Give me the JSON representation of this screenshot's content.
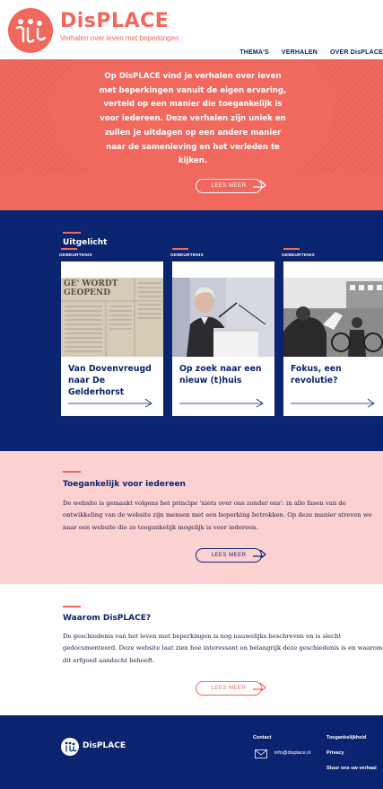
{
  "header": {
    "brand": "DisPLACE",
    "tagline": "Verhalen over leven met beperkingen",
    "nav": [
      "THEMA'S",
      "VERHALEN",
      "OVER DisPLACE"
    ]
  },
  "hero": {
    "text": "Op DisPLACE vind je verhalen over leven met beperkingen vanuit de eigen ervaring, verteld op een manier die toegankelijk is voor iedereen. Deze verhalen zijn uniek en zullen je uitdagen op een andere manier naar de samenleving en het verleden te kijken.",
    "button": "LEES MEER"
  },
  "featured": {
    "title": "Uitgelicht",
    "cards": [
      {
        "label": "GEBEURTENIS",
        "title": "Van Dovenvreugd naar De Gelderhorst",
        "image_text": "GE' WORDT GEOPEND"
      },
      {
        "label": "GEBEURTENIS",
        "title": "Op zoek naar een nieuw (t)huis"
      },
      {
        "label": "GEBEURTENIS",
        "title": "Fokus, een revolutie?"
      }
    ]
  },
  "toegankelijk": {
    "title": "Toegankelijk voor iedereen",
    "body": "De website is gemaakt volgens het principe 'niets over ons zonder ons': in alle fasen van de ontwikkeling van de website zijn mensen met een beperking betrokken. Op deze manier streven we naar een website die zo toegankelijk mogelijk is voor iedereen.",
    "button": "LEES MEER"
  },
  "waarom": {
    "title": "Waarom DisPLACE?",
    "body": "De geschiedenis van het leven met beperkingen is nog nauwelijks beschreven en is slecht gedocumenteerd. Deze website laat zien hoe interessant en belangrijk deze geschiedenis is en waarom dit erfgoed aandacht behoeft.",
    "button": "LEES MEER"
  },
  "footer": {
    "brand": "DisPLACE",
    "contact_title": "Contact",
    "email": "info@displace.nl",
    "links": [
      "Toegankelijkheid",
      "Privacy",
      "Stuur ons uw verhaal"
    ]
  },
  "colors": {
    "coral": "#f0685e",
    "navy": "#0b2470",
    "pink": "#fcd1d1"
  }
}
